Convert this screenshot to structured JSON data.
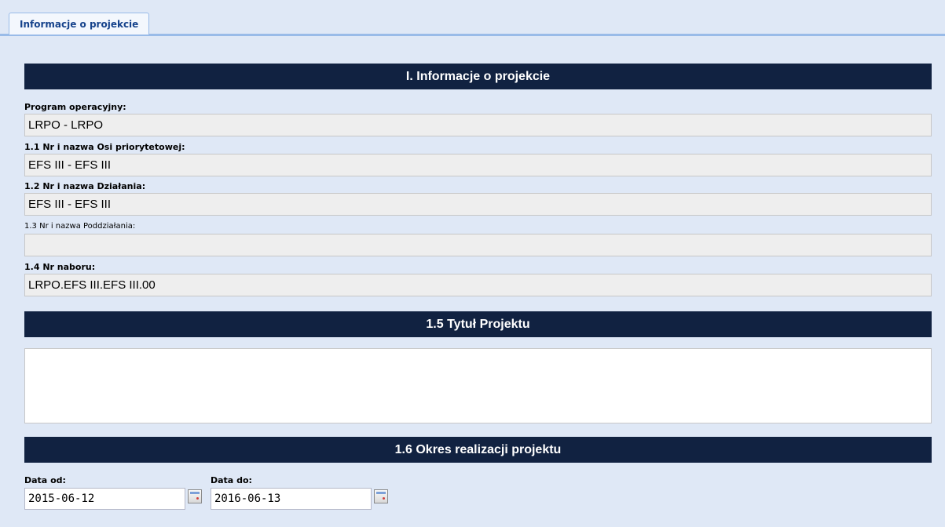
{
  "tabs": [
    {
      "label": "Informacje o projekcie"
    }
  ],
  "section1": {
    "title": "I. Informacje o projekcie",
    "fields": [
      {
        "label": "Program operacyjny:",
        "value": "LRPO - LRPO"
      },
      {
        "label": "1.1 Nr i nazwa Osi priorytetowej:",
        "value": "EFS III - EFS III"
      },
      {
        "label": "1.2 Nr i nazwa Działania:",
        "value": "EFS III - EFS III"
      },
      {
        "label": "1.3 Nr i nazwa Poddziałania:",
        "value": ""
      },
      {
        "label": "1.4 Nr naboru:",
        "value": "LRPO.EFS III.EFS III.00"
      }
    ]
  },
  "section2": {
    "title": "1.5 Tytuł Projektu",
    "value": ""
  },
  "section3": {
    "title": "1.6 Okres realizacji projektu",
    "date_from": {
      "label": "Data od:",
      "value": "2015-06-12"
    },
    "date_to": {
      "label": "Data do:",
      "value": "2016-06-13"
    }
  }
}
